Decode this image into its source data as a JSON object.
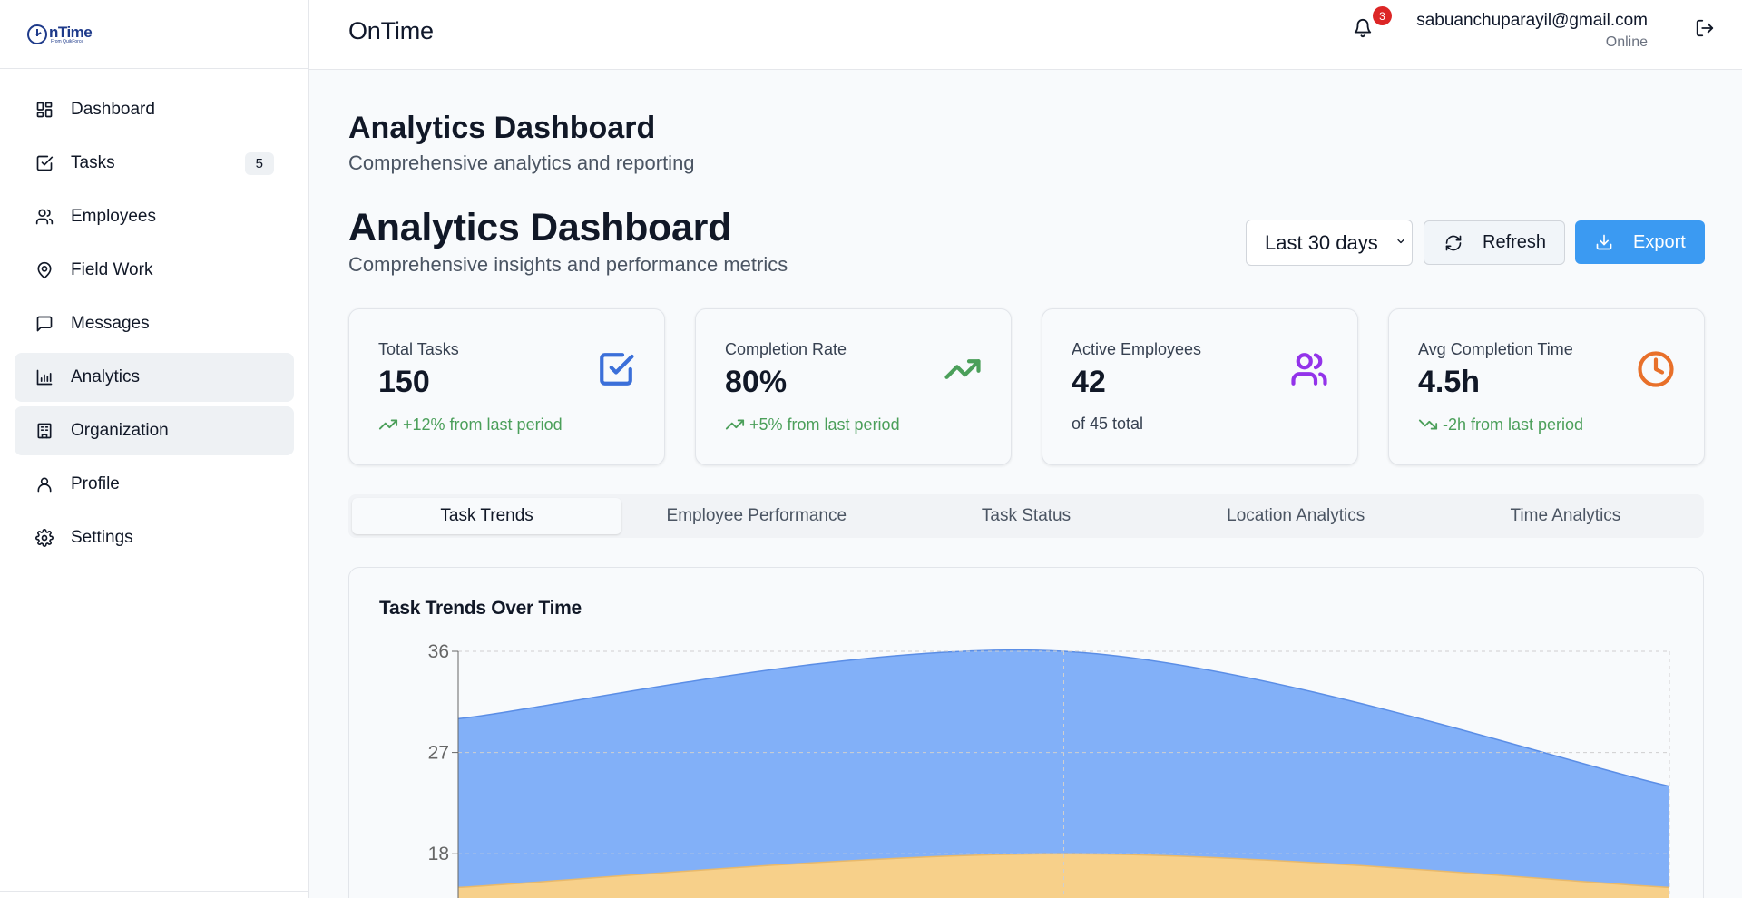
{
  "brand": {
    "logo_text": "nTime",
    "logo_subtext": "From QuikForce",
    "app_title": "OnTime"
  },
  "sidebar": {
    "items": [
      {
        "label": "Dashboard",
        "icon": "dashboard-icon"
      },
      {
        "label": "Tasks",
        "icon": "tasks-icon",
        "badge": "5"
      },
      {
        "label": "Employees",
        "icon": "users-icon"
      },
      {
        "label": "Field Work",
        "icon": "map-pin-icon"
      },
      {
        "label": "Messages",
        "icon": "message-icon"
      },
      {
        "label": "Analytics",
        "icon": "bar-chart-icon",
        "active": true
      },
      {
        "label": "Organization",
        "icon": "building-icon",
        "active": true
      },
      {
        "label": "Profile",
        "icon": "user-icon"
      },
      {
        "label": "Settings",
        "icon": "gear-icon"
      }
    ]
  },
  "header": {
    "notification_count": "3",
    "user_email": "sabuanchuparayil@gmail.com",
    "user_status": "Online"
  },
  "page": {
    "title": "Analytics Dashboard",
    "subtitle": "Comprehensive analytics and reporting"
  },
  "analytics": {
    "title": "Analytics Dashboard",
    "subtitle": "Comprehensive insights and performance metrics",
    "range_selected": "Last 30 days",
    "refresh_label": "Refresh",
    "export_label": "Export"
  },
  "stats": [
    {
      "label": "Total Tasks",
      "value": "150",
      "note": "+12% from last period",
      "trend": "up",
      "icon": "check-square-icon",
      "color": "#3b6fd9"
    },
    {
      "label": "Completion Rate",
      "value": "80%",
      "note": "+5% from last period",
      "trend": "up",
      "icon": "trending-up-icon",
      "color": "#4b9f5a"
    },
    {
      "label": "Active Employees",
      "value": "42",
      "note": "of 45 total",
      "trend": "none",
      "icon": "users-icon",
      "color": "#9333ea"
    },
    {
      "label": "Avg Completion Time",
      "value": "4.5h",
      "note": "-2h from last period",
      "trend": "down",
      "icon": "clock-icon",
      "color": "#e8702a"
    }
  ],
  "tabs": [
    {
      "label": "Task Trends",
      "active": true
    },
    {
      "label": "Employee Performance"
    },
    {
      "label": "Task Status"
    },
    {
      "label": "Location Analytics"
    },
    {
      "label": "Time Analytics"
    }
  ],
  "chart_data": {
    "type": "area",
    "title": "Task Trends Over Time",
    "y_ticks": [
      "36",
      "27",
      "18"
    ],
    "ylim": [
      9,
      36
    ],
    "grid": true,
    "x": [
      0,
      1,
      2
    ],
    "series": [
      {
        "values": [
          30,
          36,
          24
        ],
        "color": "#82b0f8"
      },
      {
        "values": [
          15,
          18,
          15
        ],
        "color": "#f7d08a"
      }
    ]
  }
}
